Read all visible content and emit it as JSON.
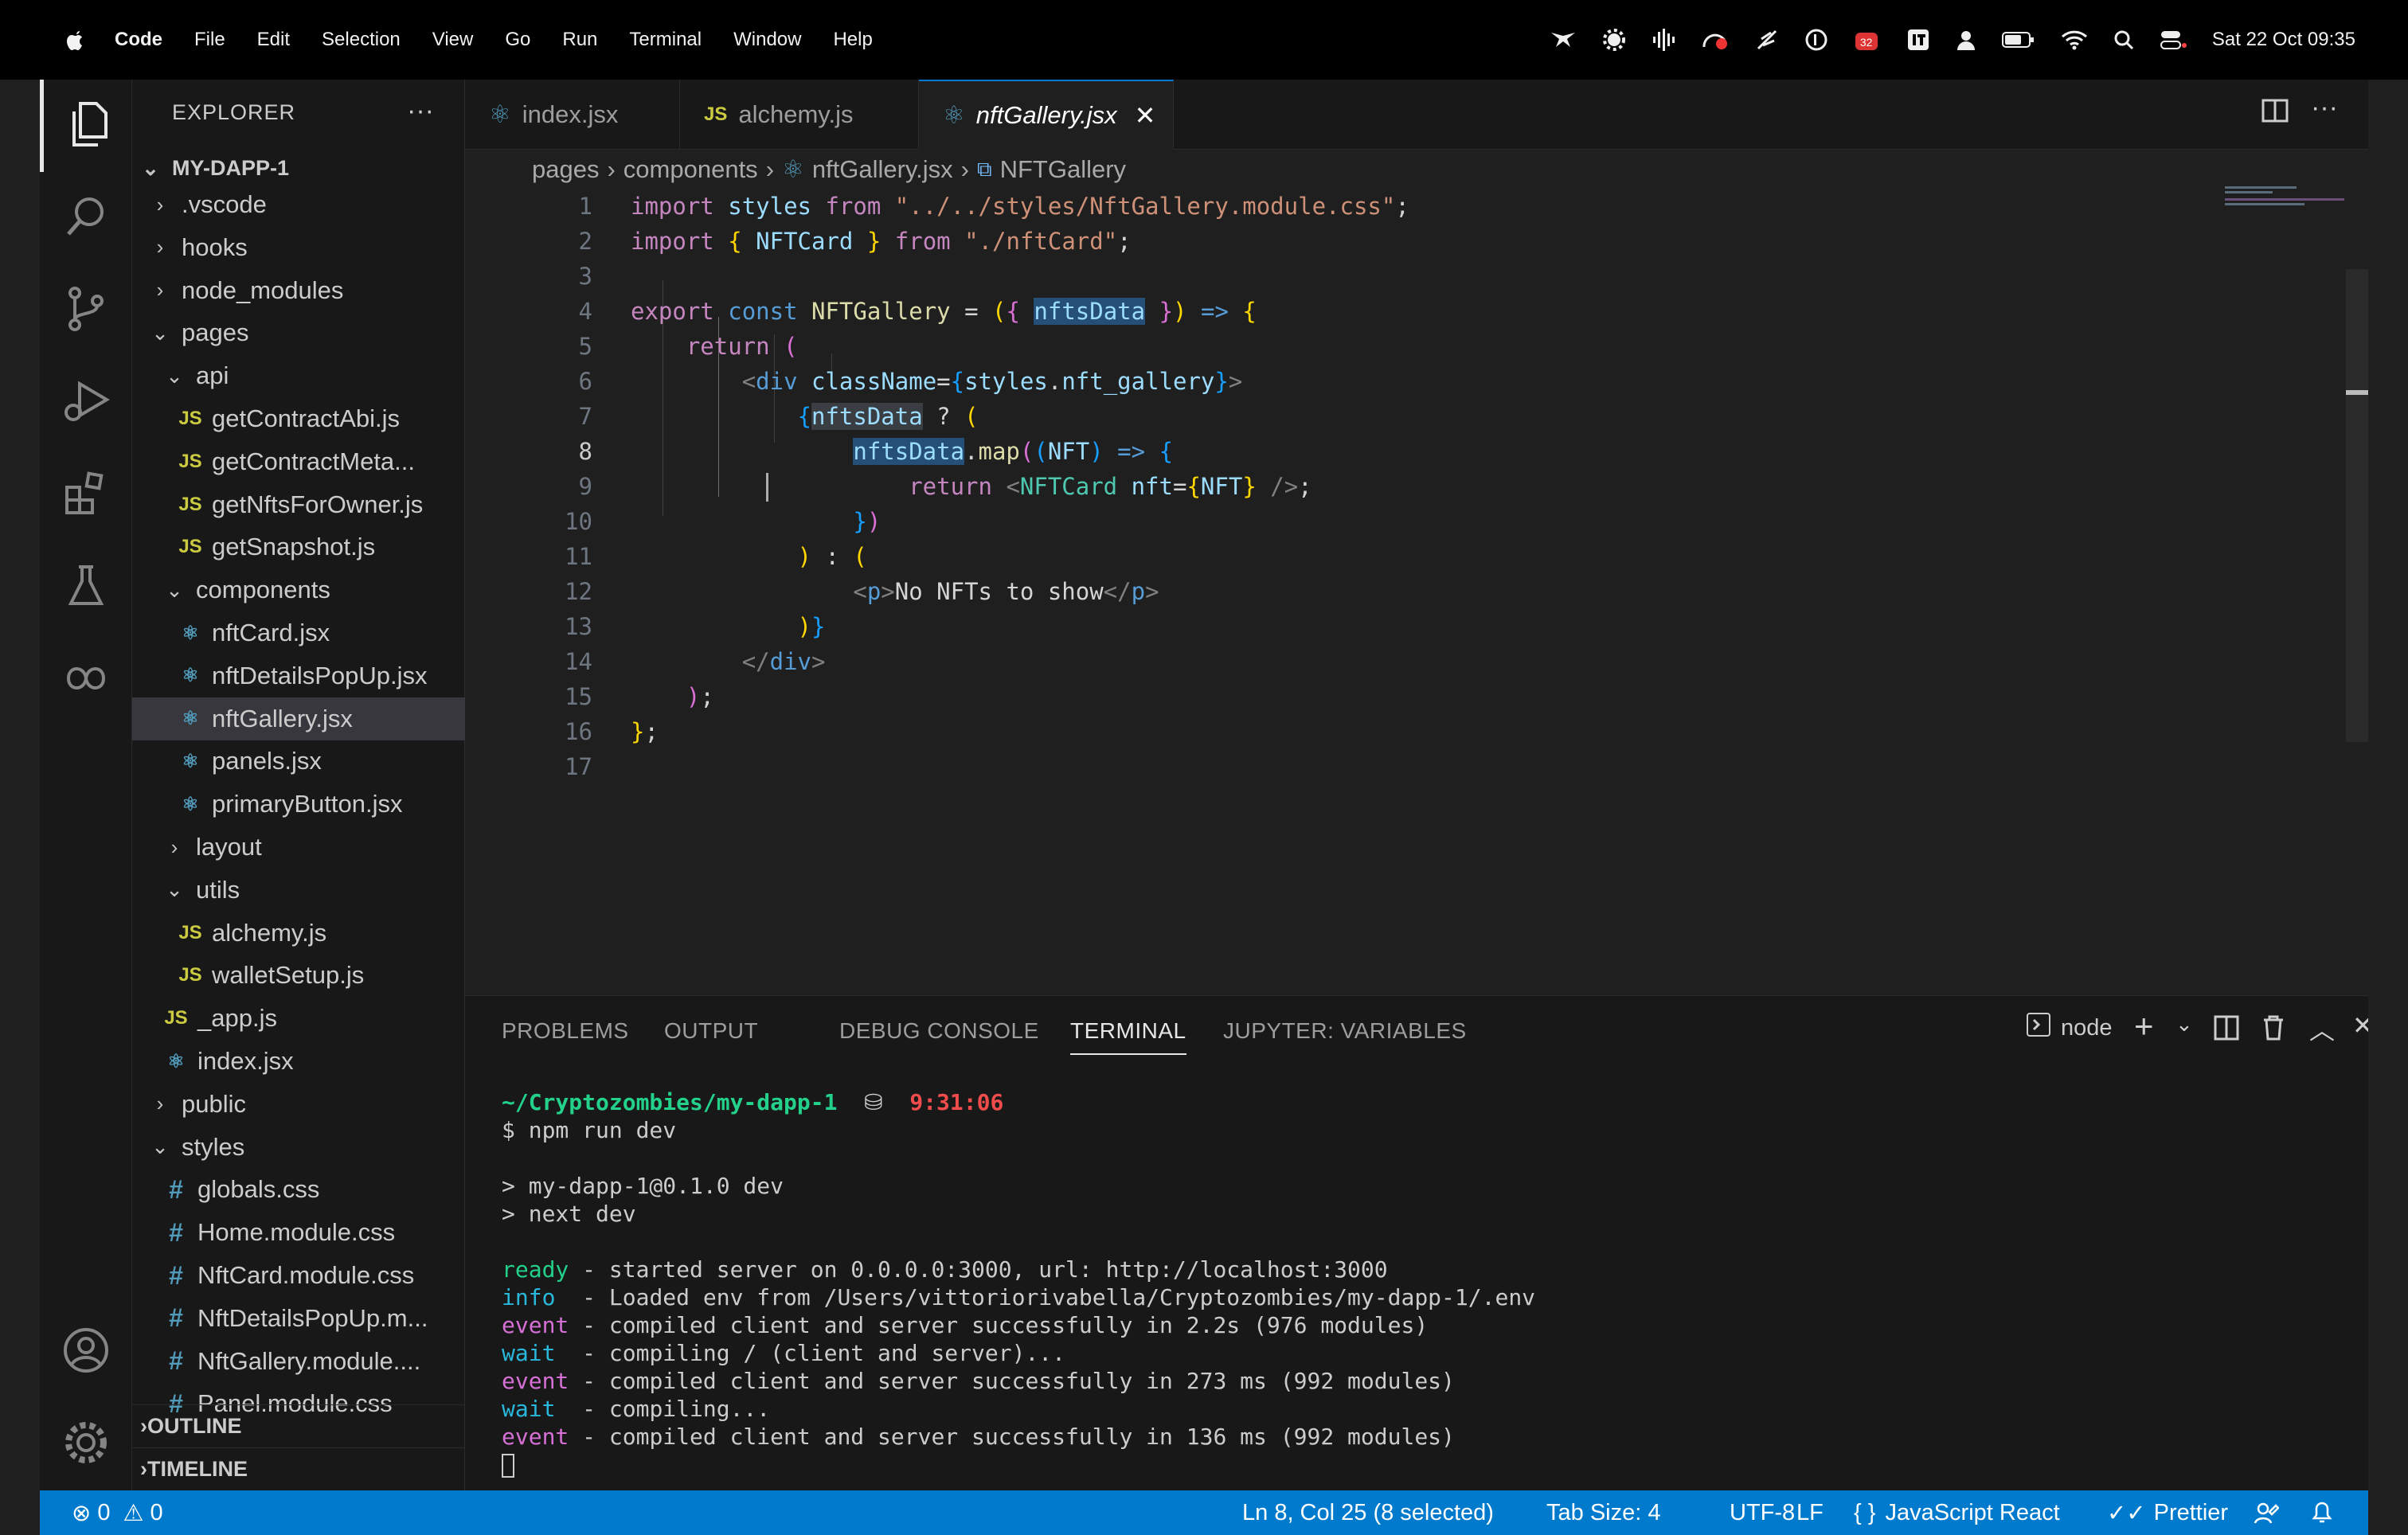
{
  "menubar": {
    "app_name": "Code",
    "items": [
      "File",
      "Edit",
      "Selection",
      "View",
      "Go",
      "Run",
      "Terminal",
      "Window",
      "Help"
    ],
    "clock": "Sat 22 Oct  09:35",
    "badge": "32"
  },
  "sidebar": {
    "title": "EXPLORER",
    "more": "···",
    "root": "MY-DAPP-1",
    "items": [
      {
        "label": ".vscode",
        "kind": "folder"
      },
      {
        "label": "hooks",
        "kind": "folder"
      },
      {
        "label": "node_modules",
        "kind": "folder"
      },
      {
        "label": "pages",
        "kind": "folder-open"
      },
      {
        "label": "api",
        "kind": "folder-open"
      },
      {
        "label": "getContractAbi.js",
        "kind": "js"
      },
      {
        "label": "getContractMeta...",
        "kind": "js"
      },
      {
        "label": "getNftsForOwner.js",
        "kind": "js"
      },
      {
        "label": "getSnapshot.js",
        "kind": "js"
      },
      {
        "label": "components",
        "kind": "folder-open"
      },
      {
        "label": "nftCard.jsx",
        "kind": "react"
      },
      {
        "label": "nftDetailsPopUp.jsx",
        "kind": "react"
      },
      {
        "label": "nftGallery.jsx",
        "kind": "react"
      },
      {
        "label": "panels.jsx",
        "kind": "react"
      },
      {
        "label": "primaryButton.jsx",
        "kind": "react"
      },
      {
        "label": "layout",
        "kind": "folder"
      },
      {
        "label": "utils",
        "kind": "folder-open"
      },
      {
        "label": "alchemy.js",
        "kind": "js"
      },
      {
        "label": "walletSetup.js",
        "kind": "js"
      },
      {
        "label": "_app.js",
        "kind": "js"
      },
      {
        "label": "index.jsx",
        "kind": "react"
      },
      {
        "label": "public",
        "kind": "folder"
      },
      {
        "label": "styles",
        "kind": "folder-open"
      },
      {
        "label": "globals.css",
        "kind": "css"
      },
      {
        "label": "Home.module.css",
        "kind": "css"
      },
      {
        "label": "NftCard.module.css",
        "kind": "css"
      },
      {
        "label": "NftDetailsPopUp.m...",
        "kind": "css"
      },
      {
        "label": "NftGallery.module....",
        "kind": "css"
      },
      {
        "label": "Panel.module.css",
        "kind": "css"
      }
    ],
    "outline": "OUTLINE",
    "timeline": "TIMELINE"
  },
  "tabs": [
    {
      "label": "index.jsx",
      "icon": "react-icon"
    },
    {
      "label": "alchemy.js",
      "icon": "js-icon"
    },
    {
      "label": "nftGallery.jsx",
      "icon": "react-icon",
      "active": true
    }
  ],
  "breadcrumb": {
    "parts": [
      "pages",
      "components",
      "nftGallery.jsx",
      "NFTGallery"
    ]
  },
  "editor": {
    "line_numbers": [
      "1",
      "2",
      "3",
      "4",
      "5",
      "6",
      "7",
      "8",
      "9",
      "10",
      "11",
      "12",
      "13",
      "14",
      "15",
      "16",
      "17"
    ],
    "current_line": "8"
  },
  "panel": {
    "tabs": [
      "PROBLEMS",
      "OUTPUT",
      "DEBUG CONSOLE",
      "TERMINAL",
      "JUPYTER: VARIABLES"
    ],
    "active_tab": "TERMINAL",
    "terminal_name": "node",
    "prompt_path": "~/Cryptozombies/my-dapp-1",
    "prompt_time": "9:31:06",
    "command": "$ npm run dev",
    "lines": [
      {
        "text": "> my-dapp-1@0.1.0 dev"
      },
      {
        "text": "> next dev"
      },
      {
        "tag": "ready",
        "text": " - started server on 0.0.0.0:3000, url: http://localhost:3000"
      },
      {
        "tag": "info",
        "text": "  - Loaded env from /Users/vittoriorivabella/Cryptozombies/my-dapp-1/.env"
      },
      {
        "tag": "event",
        "text": " - compiled client and server successfully in 2.2s (976 modules)"
      },
      {
        "tag": "wait",
        "text": "  - compiling / (client and server)..."
      },
      {
        "tag": "event",
        "text": " - compiled client and server successfully in 273 ms (992 modules)"
      },
      {
        "tag": "wait",
        "text": "  - compiling..."
      },
      {
        "tag": "event",
        "text": " - compiled client and server successfully in 136 ms (992 modules)"
      }
    ]
  },
  "statusbar": {
    "errors": "0",
    "warnings": "0",
    "position": "Ln 8, Col 25 (8 selected)",
    "tab_size": "Tab Size: 4",
    "encoding": "UTF-8",
    "eol": "LF",
    "language": "JavaScript React",
    "formatter": "Prettier"
  },
  "colors": {
    "statusbar": "#007acc",
    "editor_bg": "#1f1f1f",
    "sidebar_bg": "#181818"
  }
}
